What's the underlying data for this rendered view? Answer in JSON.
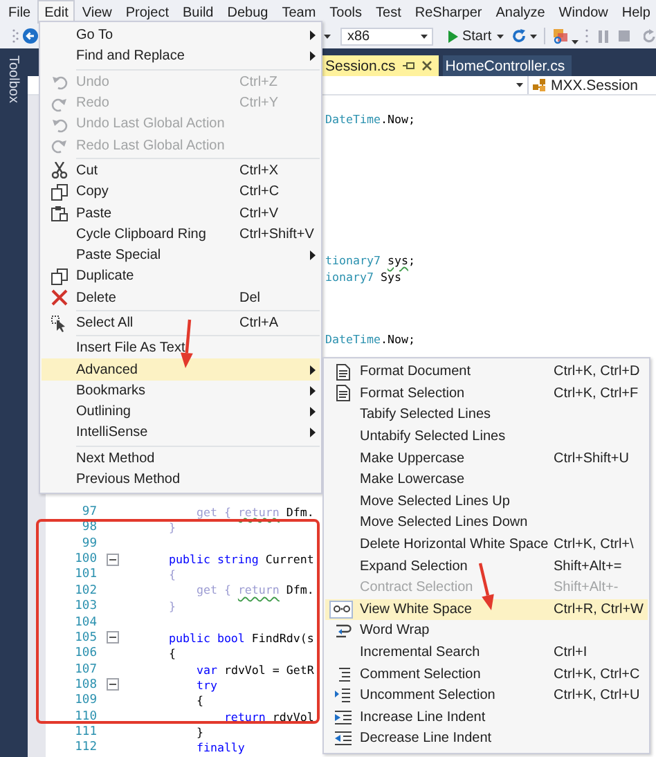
{
  "menubar": [
    {
      "label": "File",
      "selected": false
    },
    {
      "label": "Edit",
      "selected": true
    },
    {
      "label": "View",
      "selected": false
    },
    {
      "label": "Project",
      "selected": false
    },
    {
      "label": "Build",
      "selected": false
    },
    {
      "label": "Debug",
      "selected": false
    },
    {
      "label": "Team",
      "selected": false
    },
    {
      "label": "Tools",
      "selected": false
    },
    {
      "label": "Test",
      "selected": false
    },
    {
      "label": "ReSharper",
      "selected": false
    },
    {
      "label": "Analyze",
      "selected": false
    },
    {
      "label": "Window",
      "selected": false
    },
    {
      "label": "Help",
      "selected": false
    }
  ],
  "toolbar": {
    "platform": "x86",
    "start": "Start"
  },
  "toolbox": {
    "label": "Toolbox"
  },
  "tabs": [
    {
      "label": "Session.cs",
      "selected": true
    },
    {
      "label": "HomeController.cs",
      "selected": false
    }
  ],
  "navigation": {
    "member": "MXX.Session"
  },
  "code_lines": [
    {
      "kind": "fragment"
    },
    {
      "kind": "fragment",
      "tokens": [
        {
          "text": "DateTime",
          "kind": "type"
        },
        {
          "text": ".Now;",
          "kind": "plain"
        }
      ]
    },
    {
      "kind": "fragment"
    },
    {
      "kind": "fragment"
    },
    {
      "kind": "fragment"
    },
    {
      "kind": "fragment"
    },
    {
      "kind": "fragment"
    },
    {
      "kind": "fragment"
    },
    {
      "kind": "fragment"
    },
    {
      "kind": "fragment"
    },
    {
      "kind": "fragment",
      "tokens": [
        {
          "text": "tionary7 ",
          "kind": "type"
        },
        {
          "text": "sys",
          "kind": "plain",
          "squiggle": true
        },
        {
          "text": ";",
          "kind": "plain"
        }
      ]
    },
    {
      "kind": "fragment",
      "tokens": [
        {
          "text": "ionary7",
          "kind": "type"
        },
        {
          "text": " Sys",
          "kind": "plain"
        }
      ]
    },
    {
      "kind": "fragment"
    },
    {
      "kind": "fragment"
    },
    {
      "kind": "fragment"
    },
    {
      "kind": "fragment",
      "tokens": [
        {
          "text": "DateTime",
          "kind": "type"
        },
        {
          "text": ".Now;",
          "kind": "plain"
        }
      ]
    },
    {
      "kind": "fragment"
    },
    {
      "kind": "fragment"
    },
    {
      "kind": "fragment"
    },
    {
      "kind": "fragment"
    },
    {
      "kind": "fragment"
    },
    {
      "kind": "fragment"
    },
    {
      "kind": "fragment"
    },
    {
      "kind": "fragment"
    },
    {
      "kind": "fragment"
    },
    {
      "kind": "fragment"
    },
    {
      "kind": "line",
      "number": "97",
      "tokens": [
        {
          "text": "        get { ",
          "kind": "dim"
        },
        {
          "text": "return",
          "kind": "dim",
          "squiggle": true
        },
        {
          "text": " Dfm.",
          "kind": "plain"
        }
      ]
    },
    {
      "kind": "line",
      "number": "98",
      "tokens": [
        {
          "text": "    }",
          "kind": "dim"
        }
      ]
    },
    {
      "kind": "line",
      "number": "99"
    },
    {
      "kind": "line",
      "number": "100",
      "expanded": true,
      "tokens": [
        {
          "text": "    public string",
          "kind": "keyword"
        },
        {
          "text": " Current",
          "kind": "plain"
        }
      ]
    },
    {
      "kind": "line",
      "number": "101",
      "tokens": [
        {
          "text": "    {",
          "kind": "dim"
        }
      ]
    },
    {
      "kind": "line",
      "number": "102",
      "tokens": [
        {
          "text": "        get { ",
          "kind": "dim"
        },
        {
          "text": "return",
          "kind": "dim",
          "squiggle": true
        },
        {
          "text": " Dfm.",
          "kind": "plain"
        }
      ]
    },
    {
      "kind": "line",
      "number": "103",
      "tokens": [
        {
          "text": "    }",
          "kind": "dim"
        }
      ]
    },
    {
      "kind": "line",
      "number": "104"
    },
    {
      "kind": "line",
      "number": "105",
      "expanded": true,
      "tokens": [
        {
          "text": "    public bool",
          "kind": "keyword"
        },
        {
          "text": " FindRdv(s",
          "kind": "plain"
        }
      ]
    },
    {
      "kind": "line",
      "number": "106",
      "tokens": [
        {
          "text": "    {",
          "kind": "plain"
        }
      ]
    },
    {
      "kind": "line",
      "number": "107",
      "tokens": [
        {
          "text": "        var",
          "kind": "keyword"
        },
        {
          "text": " rdvVol = GetR",
          "kind": "plain"
        }
      ]
    },
    {
      "kind": "line",
      "number": "108",
      "expanded": true,
      "tokens": [
        {
          "text": "        try",
          "kind": "keyword"
        }
      ]
    },
    {
      "kind": "line",
      "number": "109",
      "tokens": [
        {
          "text": "        {",
          "kind": "plain"
        }
      ]
    },
    {
      "kind": "line",
      "number": "110",
      "tokens": [
        {
          "text": "            return",
          "kind": "keyword"
        },
        {
          "text": " rdvVol",
          "kind": "plain"
        }
      ]
    },
    {
      "kind": "line",
      "number": "111",
      "tokens": [
        {
          "text": "        }",
          "kind": "plain"
        }
      ]
    },
    {
      "kind": "line",
      "number": "112",
      "tokens": [
        {
          "text": "        finally",
          "kind": "keyword"
        }
      ]
    }
  ],
  "edit_menu": [
    {
      "kind": "item",
      "label": "Go To",
      "submenu": true,
      "disabled": false,
      "selected": false
    },
    {
      "kind": "item",
      "label": "Find and Replace",
      "submenu": true,
      "disabled": false,
      "selected": false
    },
    {
      "kind": "separator"
    },
    {
      "kind": "undo",
      "label": "Undo",
      "shortcut": "Ctrl+Z",
      "submenu": false,
      "disabled": true,
      "selected": false
    },
    {
      "kind": "redo",
      "label": "Redo",
      "shortcut": "Ctrl+Y",
      "submenu": false,
      "disabled": true,
      "selected": false
    },
    {
      "kind": "undo",
      "label": "Undo Last Global Action",
      "submenu": false,
      "disabled": true,
      "selected": false
    },
    {
      "kind": "redo",
      "label": "Redo Last Global Action",
      "submenu": false,
      "disabled": true,
      "selected": false
    },
    {
      "kind": "separator"
    },
    {
      "kind": "cut",
      "label": "Cut",
      "shortcut": "Ctrl+X",
      "submenu": false,
      "disabled": false,
      "selected": false
    },
    {
      "kind": "copy",
      "label": "Copy",
      "shortcut": "Ctrl+C",
      "submenu": false,
      "disabled": false,
      "selected": false
    },
    {
      "kind": "paste",
      "label": "Paste",
      "shortcut": "Ctrl+V",
      "submenu": false,
      "disabled": false,
      "selected": false
    },
    {
      "kind": "item",
      "label": "Cycle Clipboard Ring",
      "shortcut": "Ctrl+Shift+V",
      "submenu": false,
      "disabled": false,
      "selected": false
    },
    {
      "kind": "item",
      "label": "Paste Special",
      "submenu": true,
      "disabled": false,
      "selected": false
    },
    {
      "kind": "copy",
      "label": "Duplicate",
      "submenu": false,
      "disabled": false,
      "selected": false
    },
    {
      "kind": "delete",
      "label": "Delete",
      "shortcut": "Del",
      "submenu": false,
      "disabled": false,
      "selected": false
    },
    {
      "kind": "separator"
    },
    {
      "kind": "select",
      "label": "Select All",
      "shortcut": "Ctrl+A",
      "submenu": false,
      "disabled": false,
      "selected": false
    },
    {
      "kind": "separator"
    },
    {
      "kind": "item",
      "label": "Insert File As Text",
      "submenu": false,
      "disabled": false,
      "selected": false
    },
    {
      "kind": "item",
      "label": "Advanced",
      "submenu": true,
      "disabled": false,
      "selected": true
    },
    {
      "kind": "item",
      "label": "Bookmarks",
      "submenu": true,
      "disabled": false,
      "selected": false
    },
    {
      "kind": "item",
      "label": "Outlining",
      "submenu": true,
      "disabled": false,
      "selected": false
    },
    {
      "kind": "item",
      "label": "IntelliSense",
      "submenu": true,
      "disabled": false,
      "selected": false
    },
    {
      "kind": "separator"
    },
    {
      "kind": "item",
      "label": "Next Method",
      "submenu": false,
      "disabled": false,
      "selected": false
    },
    {
      "kind": "item",
      "label": "Previous Method",
      "submenu": false,
      "disabled": false,
      "selected": false
    }
  ],
  "advanced_menu": [
    {
      "kind": "document",
      "label": "Format Document",
      "shortcut": "Ctrl+K, Ctrl+D",
      "disabled": false,
      "selected": false,
      "checked": false
    },
    {
      "kind": "document",
      "label": "Format Selection",
      "shortcut": "Ctrl+K, Ctrl+F",
      "disabled": false,
      "selected": false,
      "checked": false
    },
    {
      "kind": "item",
      "label": "Tabify Selected Lines",
      "disabled": false,
      "selected": false,
      "checked": false
    },
    {
      "kind": "item",
      "label": "Untabify Selected Lines",
      "disabled": false,
      "selected": false,
      "checked": false
    },
    {
      "kind": "item",
      "label": "Make Uppercase",
      "shortcut": "Ctrl+Shift+U",
      "disabled": false,
      "selected": false,
      "checked": false
    },
    {
      "kind": "item",
      "label": "Make Lowercase",
      "disabled": false,
      "selected": false,
      "checked": false
    },
    {
      "kind": "item",
      "label": "Move Selected Lines Up",
      "disabled": false,
      "selected": false,
      "checked": false
    },
    {
      "kind": "item",
      "label": "Move Selected Lines Down",
      "disabled": false,
      "selected": false,
      "checked": false
    },
    {
      "kind": "item",
      "label": "Delete Horizontal White Space",
      "shortcut": "Ctrl+K, Ctrl+\\",
      "disabled": false,
      "selected": false,
      "checked": false
    },
    {
      "kind": "item",
      "label": "Expand Selection",
      "shortcut": "Shift+Alt+=",
      "disabled": false,
      "selected": false,
      "checked": false
    },
    {
      "kind": "item",
      "label": "Contract Selection",
      "shortcut": "Shift+Alt+-",
      "disabled": true,
      "selected": false,
      "checked": false
    },
    {
      "kind": "whitespace",
      "label": "View White Space",
      "shortcut": "Ctrl+R, Ctrl+W",
      "disabled": false,
      "selected": true,
      "checked": true
    },
    {
      "kind": "wrap",
      "label": "Word Wrap",
      "disabled": false,
      "selected": false,
      "checked": false
    },
    {
      "kind": "item",
      "label": "Incremental Search",
      "shortcut": "Ctrl+I",
      "disabled": false,
      "selected": false,
      "checked": false
    },
    {
      "kind": "comment",
      "label": "Comment Selection",
      "shortcut": "Ctrl+K, Ctrl+C",
      "disabled": false,
      "selected": false,
      "checked": false
    },
    {
      "kind": "uncomment",
      "label": "Uncomment Selection",
      "shortcut": "Ctrl+K, Ctrl+U",
      "disabled": false,
      "selected": false,
      "checked": false
    },
    {
      "kind": "indent",
      "label": "Increase Line Indent",
      "disabled": false,
      "selected": false,
      "checked": false
    },
    {
      "kind": "outdent",
      "label": "Decrease Line Indent",
      "disabled": false,
      "selected": false,
      "checked": false
    }
  ],
  "annotations": [
    {
      "kind": "frame"
    },
    {
      "kind": "arrow"
    },
    {
      "kind": "arrow"
    }
  ]
}
